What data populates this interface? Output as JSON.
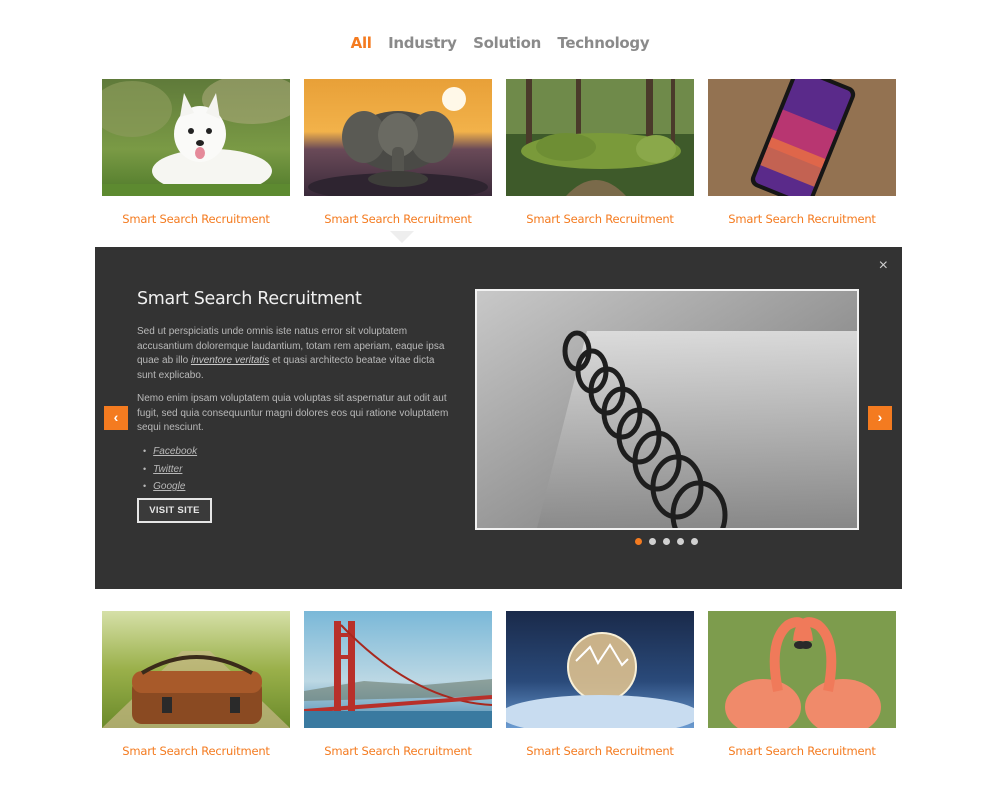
{
  "filters": [
    {
      "label": "All",
      "active": true
    },
    {
      "label": "Industry"
    },
    {
      "label": "Solution"
    },
    {
      "label": "Technology"
    }
  ],
  "top_items": [
    {
      "caption": "Smart Search Recruitment",
      "image": "white-dog-on-grass"
    },
    {
      "caption": "Smart Search Recruitment",
      "image": "elephant-statue-sunset",
      "selected": true
    },
    {
      "caption": "Smart Search Recruitment",
      "image": "moss-sculpture-forest"
    },
    {
      "caption": "Smart Search Recruitment",
      "image": "smartphone-on-table"
    }
  ],
  "bottom_items": [
    {
      "caption": "Smart Search Recruitment",
      "image": "leather-bag-on-road"
    },
    {
      "caption": "Smart Search Recruitment",
      "image": "golden-gate-bridge"
    },
    {
      "caption": "Smart Search Recruitment",
      "image": "frozen-bubble-snow"
    },
    {
      "caption": "Smart Search Recruitment",
      "image": "flamingos-heart"
    }
  ],
  "panel": {
    "title": "Smart Search Recruitment",
    "para1_start": "Sed ut perspiciatis unde omnis iste natus error sit voluptatem accusantium doloremque laudantium, totam rem aperiam, eaque ipsa quae ab illo ",
    "para1_link": "inventore veritatis",
    "para1_end": " et quasi architecto beatae vitae dicta sunt explicabo.",
    "para2": "Nemo enim ipsam voluptatem quia voluptas sit aspernatur aut odit aut fugit, sed quia consequuntur magni dolores eos qui ratione voluptatem sequi nesciunt.",
    "links": [
      "Facebook",
      "Twitter",
      "Google"
    ],
    "visit_label": "VISIT SITE",
    "close_icon": "×",
    "prev_icon": "‹",
    "next_icon": "›",
    "slide_image": "spiral-notebook-bw",
    "slide_count": 5,
    "active_slide": 1
  },
  "colors": {
    "accent": "#f47b20",
    "panel_bg": "#333333",
    "muted_text": "#8a8a8a"
  }
}
